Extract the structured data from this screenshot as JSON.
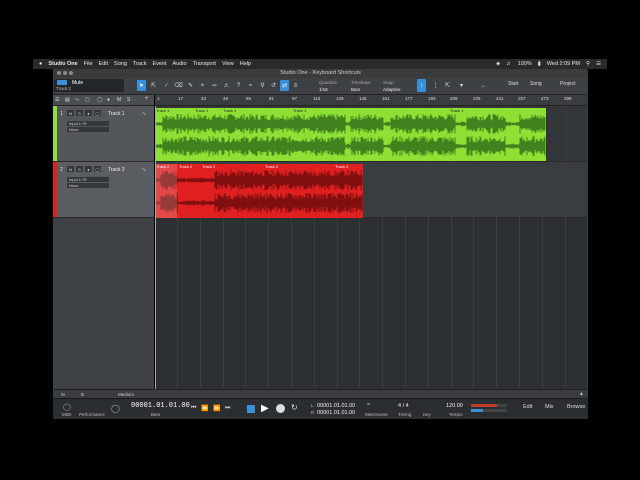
{
  "menubar": {
    "apple": "",
    "app": "Studio One",
    "items": [
      "File",
      "Edit",
      "Song",
      "Track",
      "Event",
      "Audio",
      "Transport",
      "View",
      "Help"
    ],
    "battery": "100%",
    "clock": "Wed 2:09 PM"
  },
  "window": {
    "title": "Studio One - Keyboard Shortcuts"
  },
  "toolbar": {
    "track_label": "Mute",
    "track_sub": "Track 2",
    "quantize_label": "Quantize",
    "quantize_value": "1/16",
    "timebase_label": "Timebase",
    "timebase_value": "Bars",
    "snap_label": "Snap",
    "snap_value": "Adaptive",
    "start": "Start",
    "song": "Song",
    "project": "Project"
  },
  "ruler": {
    "ticks": [
      "1",
      "17",
      "33",
      "49",
      "65",
      "81",
      "97",
      "113",
      "129",
      "145",
      "161",
      "177",
      "193",
      "209",
      "225",
      "241",
      "257",
      "273",
      "289"
    ]
  },
  "tracks": [
    {
      "num": "1",
      "name": "Track 1",
      "input": "Input L+R",
      "output": "None",
      "color": "#8ee034",
      "clips": [
        "Track 1",
        "Track 1",
        "Track 1",
        "Track 1",
        "Track 1"
      ]
    },
    {
      "num": "2",
      "name": "Track 2",
      "input": "Input L+R",
      "output": "None",
      "color": "#e02020",
      "clips": [
        "Track 2",
        "Track 2",
        "Track 2",
        "Track 2",
        "Track 2"
      ]
    }
  ],
  "bottom": {
    "m": "M",
    "b": "B",
    "size": "Medium"
  },
  "transport": {
    "midi": "MIDI",
    "performance": "Performance",
    "position": "00001.01.01.00",
    "position_label": "Bars",
    "left_loc": "00001.01.01.00",
    "right_loc": "00001.01.01.00",
    "l": "L",
    "r": "R",
    "metronome": "Metronome",
    "timesig": "4 / 4",
    "timing": "Timing",
    "key_label": "Key",
    "tempo": "120.00",
    "tempo_label": "Tempo",
    "edit": "Edit",
    "mix": "Mix",
    "browse": "Browse"
  },
  "colors": {
    "accent": "#3b8ed8",
    "track1": "#8ee034",
    "track2": "#e02020"
  }
}
